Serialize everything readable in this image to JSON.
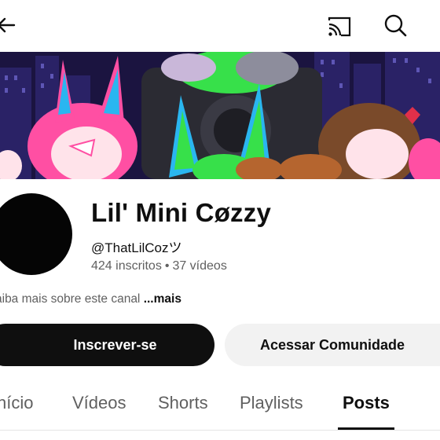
{
  "topbar": {
    "icons": [
      "back-arrow-icon",
      "cast-icon",
      "search-icon"
    ]
  },
  "banner": {
    "description_colors": {
      "sky": "#1b1440",
      "accent_pink": "#ff4fa3",
      "accent_green": "#37e04a",
      "accent_cyan": "#2ab6f0"
    }
  },
  "channel": {
    "name": "Lil' Mini Cøzzy",
    "handle": "@ThatLilCozツ",
    "subscribers": "424 inscritos",
    "separator": "•",
    "videos": "37 vídeos",
    "about_text": "aiba mais sobre este canal ",
    "about_more": "...mais"
  },
  "actions": {
    "subscribe_label": "Inscrever-se",
    "community_label": "Acessar Comunidade"
  },
  "tabs": {
    "items": [
      {
        "label": "nício",
        "active": false
      },
      {
        "label": "Vídeos",
        "active": false
      },
      {
        "label": "Shorts",
        "active": false
      },
      {
        "label": "Playlists",
        "active": false
      },
      {
        "label": "Posts",
        "active": true
      }
    ]
  }
}
